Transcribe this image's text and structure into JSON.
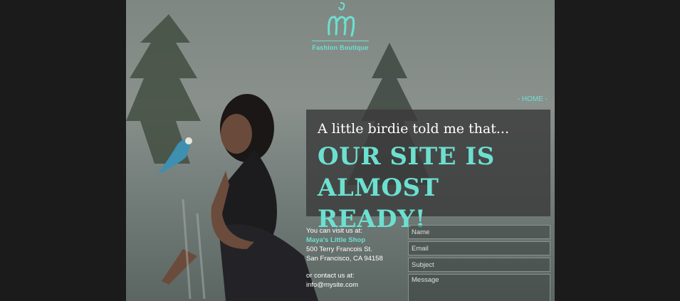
{
  "logo": {
    "monogram": "m",
    "text": "Fashion Boutique"
  },
  "nav": {
    "home": "- HOME -"
  },
  "hero": {
    "tagline": "A little birdie told me that...",
    "headline_line1": "OUR SITE IS",
    "headline_line2": "ALMOST READY!"
  },
  "contact": {
    "visit_label": "You can visit us at:",
    "shop_name": "Maya's Little Shop",
    "address_line1": "500 Terry Francois St.",
    "address_line2": "San Francisco, CA 94158",
    "contact_label": "or contact us at:",
    "email": "info@mysite.com"
  },
  "form": {
    "name_placeholder": "Name",
    "email_placeholder": "Email",
    "subject_placeholder": "Subject",
    "message_placeholder": "Message"
  },
  "colors": {
    "accent": "#6ce0d0",
    "panel": "#3a3a3a",
    "side": "#1b1b1b"
  }
}
